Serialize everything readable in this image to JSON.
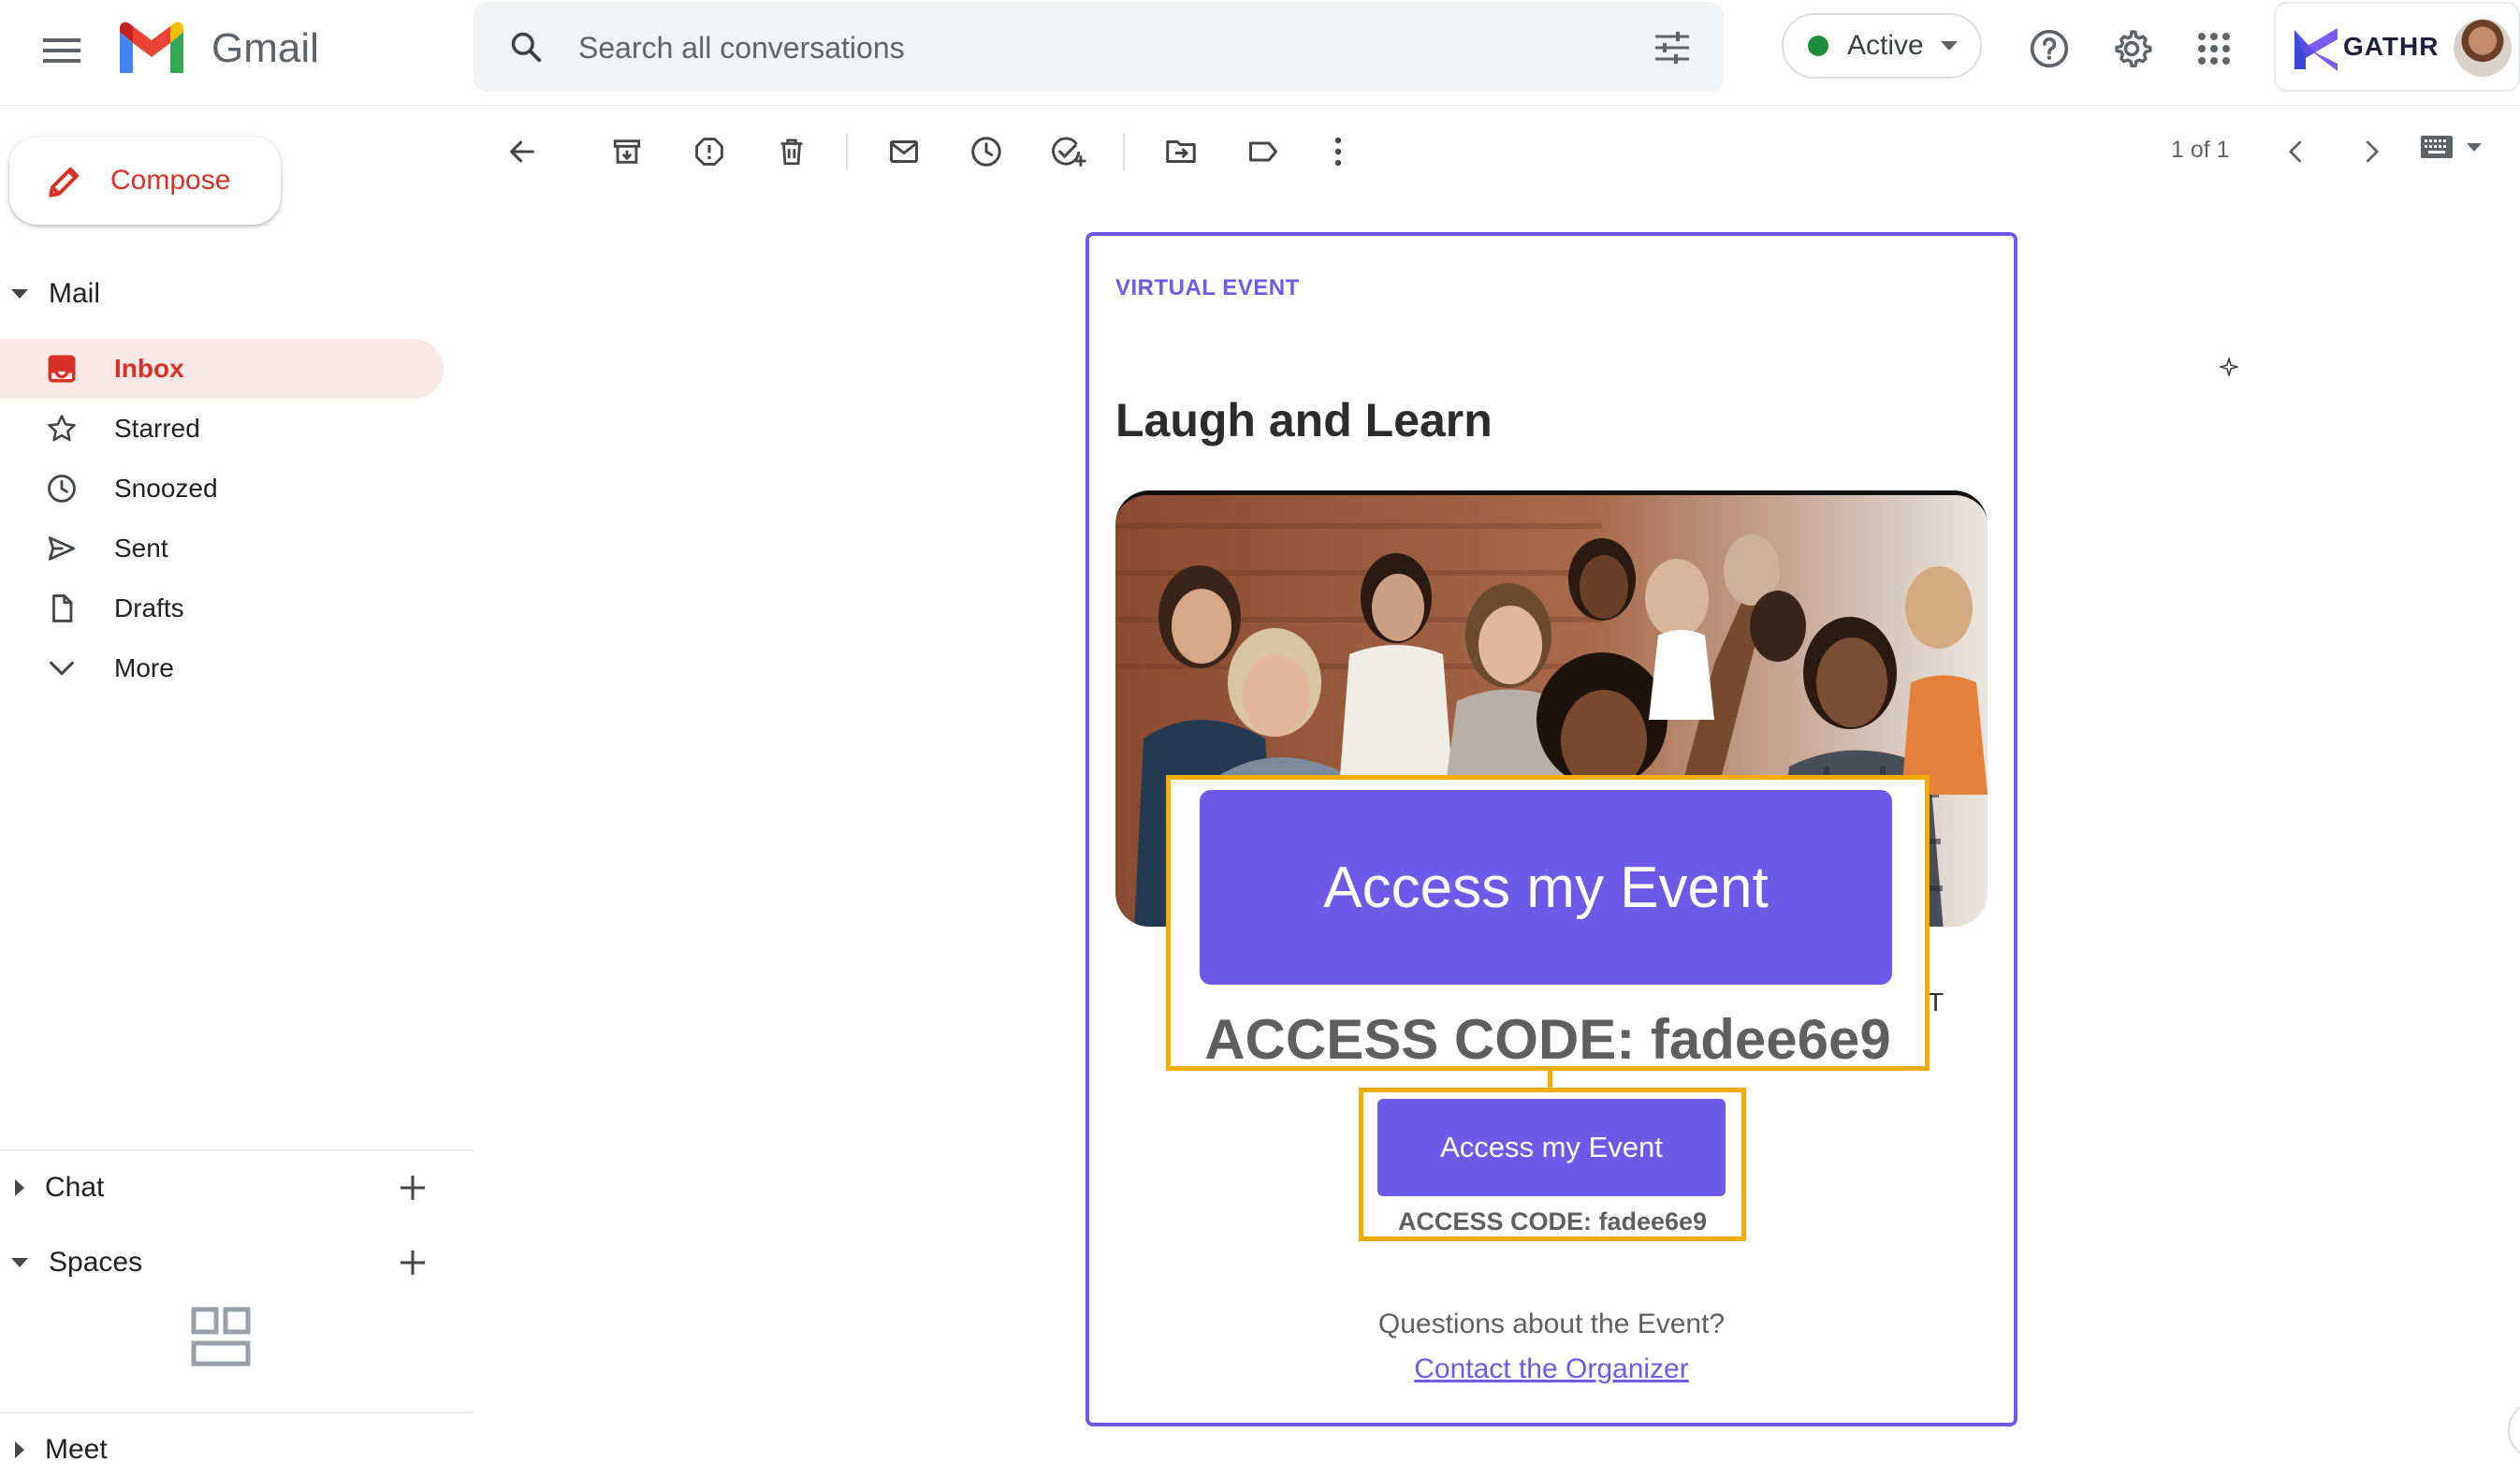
{
  "app": {
    "name": "Gmail"
  },
  "header": {
    "search_placeholder": "Search all conversations",
    "status": {
      "label": "Active",
      "color": "#1e8e3e"
    },
    "account": {
      "brand": "GATHR"
    },
    "icons": [
      "menu-icon",
      "gmail-logo-icon",
      "search-icon",
      "filter-options-icon",
      "help-icon",
      "gear-icon",
      "apps-grid-icon",
      "avatar"
    ]
  },
  "sidebar": {
    "compose_label": "Compose",
    "mail_section": "Mail",
    "items": [
      {
        "label": "Inbox",
        "icon": "inbox-icon",
        "selected": true
      },
      {
        "label": "Starred",
        "icon": "star-icon"
      },
      {
        "label": "Snoozed",
        "icon": "clock-icon"
      },
      {
        "label": "Sent",
        "icon": "send-icon"
      },
      {
        "label": "Drafts",
        "icon": "draft-icon"
      },
      {
        "label": "More",
        "icon": "chevron-down-icon"
      }
    ],
    "chat_section": "Chat",
    "spaces_section": "Spaces",
    "meet_section": "Meet"
  },
  "toolbar": {
    "icons": [
      "back-arrow-icon",
      "archive-icon",
      "report-spam-icon",
      "delete-icon",
      "mark-unread-icon",
      "snooze-icon",
      "add-task-icon",
      "move-to-icon",
      "label-icon",
      "more-vert-icon"
    ],
    "pager": "1 of 1"
  },
  "email": {
    "event_type": "VIRTUAL EVENT",
    "title": "Laugh and Learn",
    "stray_char": "T",
    "callout": {
      "button_label": "Access my Event",
      "access_code": "ACCESS CODE: fadee6e9"
    },
    "button_label": "Access my Event",
    "access_code": "ACCESS CODE: fadee6e9",
    "questions": "Questions about the Event?",
    "contact_link": "Contact the Organizer"
  },
  "colors": {
    "accent": "#6e59e8",
    "highlight": "#f2ac00",
    "gmail_red": "#d93025",
    "inbox_selected_bg": "#fce8e6"
  }
}
